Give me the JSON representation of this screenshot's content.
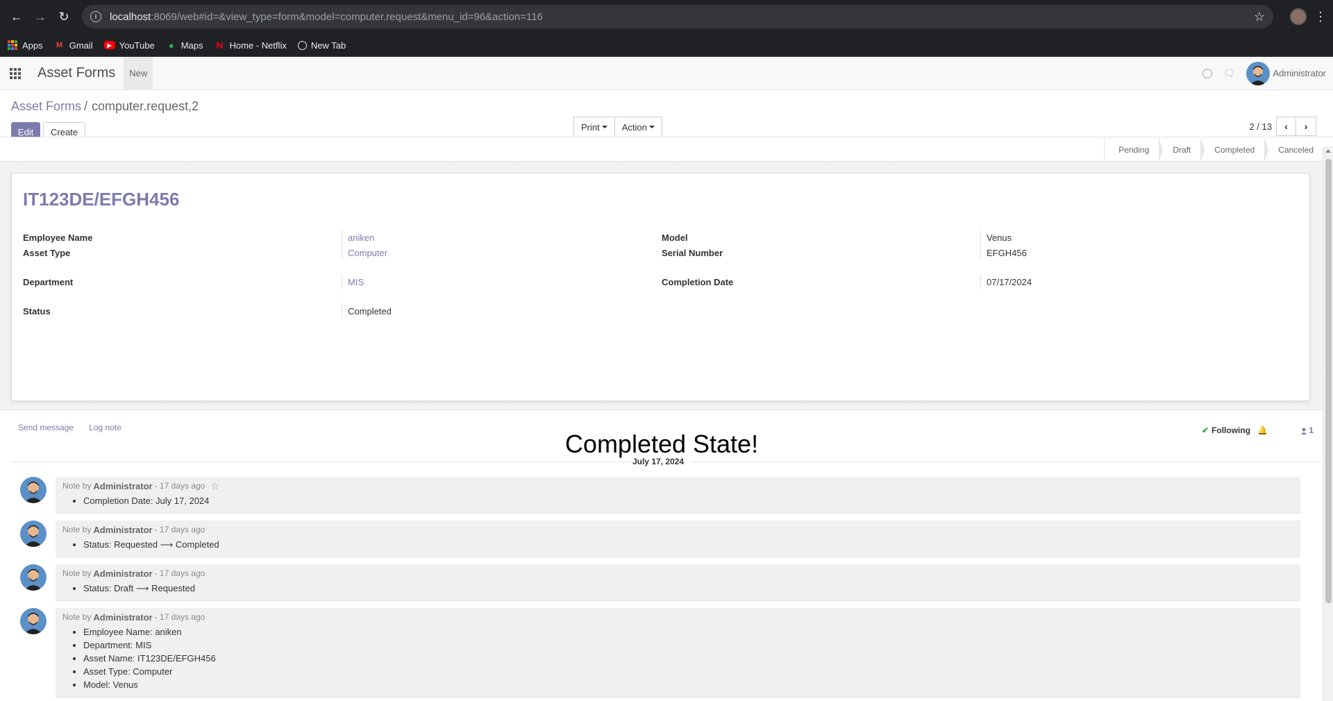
{
  "browser": {
    "url_host": "localhost",
    "url_rest": ":8069/web#id=&view_type=form&model=computer.request&menu_id=96&action=116",
    "bookmarks": [
      {
        "label": "Apps",
        "icon": "apps-icon"
      },
      {
        "label": "Gmail",
        "icon": "gmail-icon"
      },
      {
        "label": "YouTube",
        "icon": "youtube-icon"
      },
      {
        "label": "Maps",
        "icon": "maps-icon"
      },
      {
        "label": "Home - Netflix",
        "icon": "netflix-icon"
      },
      {
        "label": "New Tab",
        "icon": "globe-icon"
      }
    ]
  },
  "navbar": {
    "app_title": "Asset Forms",
    "menu_new": "New",
    "user_name": "Administrator"
  },
  "control_panel": {
    "breadcrumb_parent": "Asset Forms",
    "breadcrumb_separator": "/",
    "breadcrumb_current": "computer.request,2",
    "edit_label": "Edit",
    "create_label": "Create",
    "print_label": "Print",
    "action_label": "Action",
    "pager_value": "2 / 13"
  },
  "statusbar": {
    "stages": [
      "Pending",
      "Draft",
      "Completed",
      "Canceled"
    ]
  },
  "record": {
    "title": "IT123DE/EFGH456",
    "employee_name_label": "Employee Name",
    "employee_name": "aniken",
    "asset_type_label": "Asset Type",
    "asset_type": "Computer",
    "department_label": "Department",
    "department": "MIS",
    "status_label": "Status",
    "status": "Completed",
    "model_label": "Model",
    "model": "Venus",
    "serial_label": "Serial Number",
    "serial": "EFGH456",
    "completion_date_label": "Completion Date",
    "completion_date": "07/17/2024"
  },
  "chatter": {
    "send_message": "Send message",
    "log_note": "Log note",
    "following": "Following",
    "followers_count": "1",
    "heading": "Completed State!",
    "date_separator": "July 17, 2024",
    "messages": [
      {
        "prefix": "Note by",
        "author": "Administrator",
        "time": "- 17 days ago",
        "items": [
          "Completion Date: July 17, 2024"
        ]
      },
      {
        "prefix": "Note by",
        "author": "Administrator",
        "time": "- 17 days ago",
        "items": [
          "Status: Requested ⟶ Completed"
        ]
      },
      {
        "prefix": "Note by",
        "author": "Administrator",
        "time": "- 17 days ago",
        "items": [
          "Status: Draft ⟶ Requested"
        ]
      },
      {
        "prefix": "Note by",
        "author": "Administrator",
        "time": "- 17 days ago",
        "items": [
          "Employee Name: aniken",
          "Department: MIS",
          "Asset Name: IT123DE/EFGH456",
          "Asset Type: Computer",
          "Model: Venus"
        ]
      }
    ]
  },
  "colors": {
    "brand": "#7c7bad",
    "chrome_bg": "#202124",
    "following_check": "#28a745"
  }
}
